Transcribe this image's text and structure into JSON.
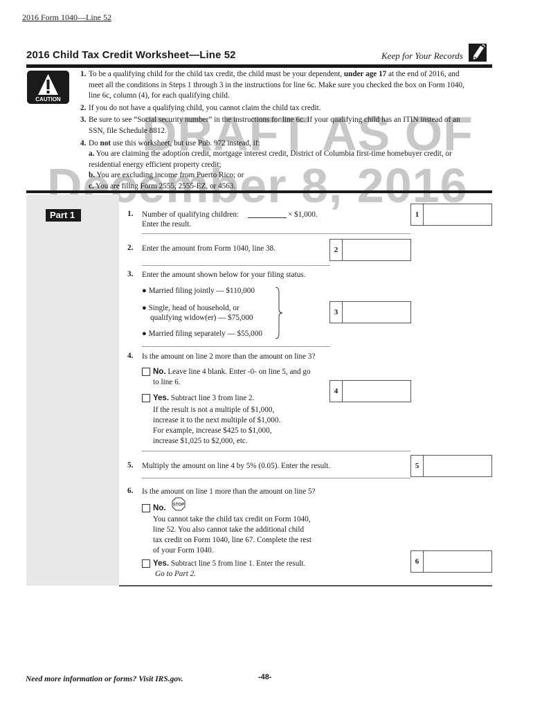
{
  "running_head": "2016 Form 1040—Line 52",
  "title": "2016 Child Tax Credit Worksheet—Line 52",
  "keep_for_records": "Keep for Your Records",
  "icons": {
    "pencil": "pencil-icon",
    "caution": "caution-warning-icon",
    "stop": "stop-sign-icon",
    "checkbox": "checkbox"
  },
  "caution_label": "CAUTION",
  "stop_label": "STOP",
  "watermark": {
    "line1": "DRAFT AS OF",
    "line2": "December 8, 2016",
    "color": "#c8c8c8"
  },
  "notes": [
    {
      "num": "1.",
      "pre": "To be a qualifying child for the child tax credit, the child must be your dependent, ",
      "bold": "under age 17",
      "post": " at the end of 2016, and meet all the conditions in Steps 1 through 3 in the instructions for line 6c. Make sure you checked the box on Form 1040, line 6c, column (4), for each qualifying child."
    },
    {
      "num": "2.",
      "text": "If you do not have a qualifying child, you cannot claim the child tax credit."
    },
    {
      "num": "3.",
      "text": "Be sure to see “Social security number” in the instructions for line 6c. If your qualifying child has an ITIN instead of an SSN, file Schedule 8812."
    },
    {
      "num": "4.",
      "pre": "Do ",
      "bold": "not",
      "post": " use this worksheet, but use Pub. 972 instead, if:",
      "subs": [
        {
          "letter": "a.",
          "text": " You are claiming the adoption credit, mortgage interest credit, District of Columbia first-time homebuyer credit, or residential energy efficient property credit;"
        },
        {
          "letter": "b.",
          "text": " You are excluding income from Puerto Rico; or"
        },
        {
          "letter": "c.",
          "text": " You are filing Form 2555, 2555-EZ, or 4563."
        }
      ]
    }
  ],
  "part": {
    "label": "Part 1"
  },
  "lines": {
    "l1": {
      "num": "1.",
      "text_a": "Number of qualifying children:",
      "text_b": "×  $1,000.",
      "text_c": "Enter the result.",
      "box": "1",
      "value": ""
    },
    "l2": {
      "num": "2.",
      "text": "Enter the amount from Form 1040, line 38.",
      "box": "2",
      "value": ""
    },
    "l3": {
      "num": "3.",
      "text": "Enter the amount shown below for your filing status.",
      "options": [
        "Married filing jointly — $110,000",
        "Single, head of household, or",
        "qualifying widow(er) — $75,000",
        "Married filing separately — $55,000"
      ],
      "box": "3",
      "value": ""
    },
    "l4": {
      "num": "4.",
      "text": "Is the amount on line 2 more than the amount on line 3?",
      "no_label": "No.",
      "no_text": "Leave line 4 blank. Enter -0- on line 5, and go",
      "no_text2": "to line 6.",
      "yes_label": "Yes.",
      "yes_text": "Subtract line 3 from line 2.",
      "yes_detail": [
        "If the result is not a multiple of $1,000,",
        "increase it to the next multiple of $1,000.",
        "For example, increase $425 to $1,000,",
        "increase $1,025 to $2,000, etc."
      ],
      "box": "4",
      "value": ""
    },
    "l5": {
      "num": "5.",
      "text": "Multiply the amount on line 4 by 5% (0.05). Enter the result.",
      "box": "5",
      "value": ""
    },
    "l6": {
      "num": "6.",
      "text": "Is the amount on line 1 more than the amount on line 5?",
      "no_label": "No.",
      "no_detail": [
        "You cannot take the child tax credit on Form 1040,",
        "line 52. You also cannot take the additional child",
        "tax credit on Form 1040, line 67. Complete the rest",
        "of your Form 1040."
      ],
      "yes_label": "Yes.",
      "yes_text": "Subtract line 5 from line 1. Enter the result.",
      "yes_goto": "Go to Part 2.",
      "box": "6",
      "value": ""
    }
  },
  "footer": {
    "left": "Need more information or forms? Visit IRS.gov.",
    "page": "-48-"
  }
}
